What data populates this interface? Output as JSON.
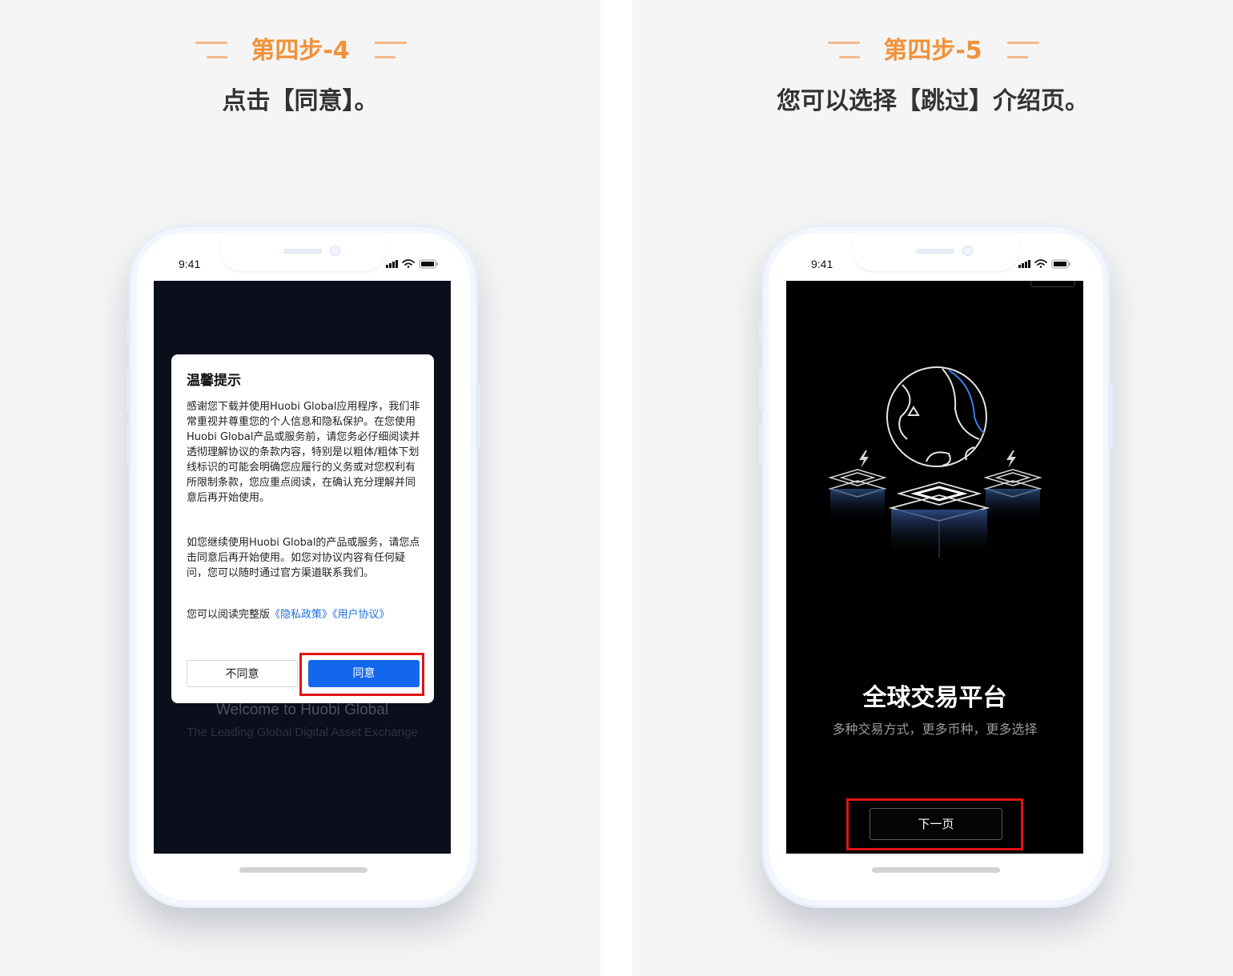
{
  "colors": {
    "accent": "#f0923a",
    "highlight": "#e01414",
    "primary_button": "#1367ec",
    "link": "#1f6fe0"
  },
  "left": {
    "step_title": "第四步-4",
    "step_desc": "点击【同意】。",
    "status_time": "9:41",
    "status_icons": [
      "signal-icon",
      "wifi-icon",
      "battery-icon"
    ],
    "dialog": {
      "title": "温馨提示",
      "para1": "感谢您下载并使用Huobi Global应用程序，我们非常重视并尊重您的个人信息和隐私保护。在您使用Huobi Global产品或服务前，请您务必仔细阅读并透彻理解协议的条款内容，特别是以粗体/粗体下划线标识的可能会明确您应履行的义务或对您权利有所限制条款，您应重点阅读，在确认充分理解并同意后再开始使用。",
      "para2": "如您继续使用Huobi Global的产品或服务，请您点击同意后再开始使用。如您对协议内容有任何疑问，您可以随时通过官方渠道联系我们。",
      "read_prefix": "您可以阅读完整版",
      "privacy_link": "《隐私政策》",
      "user_link": "《用户协议》",
      "disagree": "不同意",
      "agree": "同意"
    },
    "welcome_title": "Welcome to Huobi Global",
    "welcome_sub": "The Leading Global Digital Asset Exchange"
  },
  "right": {
    "step_title": "第四步-5",
    "step_desc": "您可以选择【跳过】介绍页。",
    "status_time": "9:41",
    "status_icons": [
      "signal-icon",
      "wifi-icon",
      "battery-icon"
    ],
    "illustration": "globe-with-platforms-illustration",
    "promo_title": "全球交易平台",
    "promo_sub": "多种交易方式，更多币种，更多选择",
    "next_button": "下一页"
  }
}
